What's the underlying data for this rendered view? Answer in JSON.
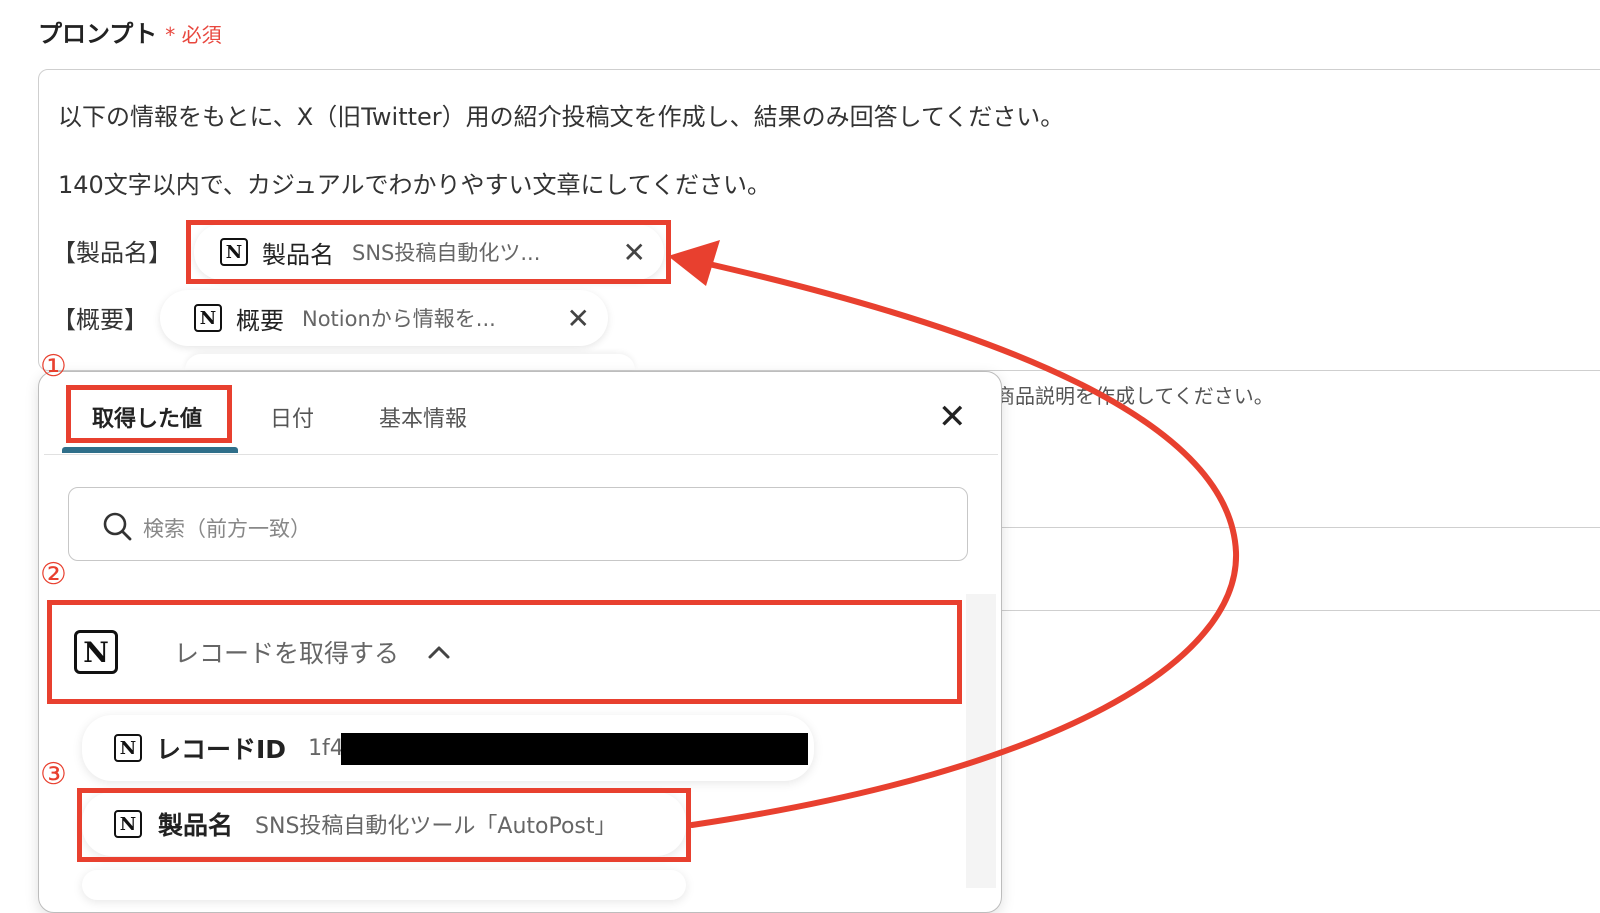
{
  "field": {
    "title": "プロンプト",
    "required_mark": "*",
    "required_label": "必須"
  },
  "prompt": {
    "line1": "以下の情報をもとに、X（旧Twitter）用の紹介投稿文を作成し、結果のみ回答してください。",
    "line2": "140文字以内で、カジュアルでわかりやすい文章にしてください。",
    "label_product": "【製品名】",
    "label_summary": "【概要】",
    "chip_product": {
      "label": "製品名",
      "value": "SNS投稿自動化ツ..."
    },
    "chip_summary": {
      "label": "概要",
      "value": "Notionから情報を..."
    },
    "bg_text": "商品説明を作成してください。"
  },
  "panel": {
    "tabs": [
      {
        "label": "取得した値"
      },
      {
        "label": "日付"
      },
      {
        "label": "基本情報"
      }
    ],
    "search_placeholder": "検索（前方一致）",
    "group": {
      "label": "レコードを取得する"
    },
    "items": [
      {
        "label": "レコードID",
        "value": "1f4"
      },
      {
        "label": "製品名",
        "value": "SNS投稿自動化ツール「AutoPost」"
      }
    ]
  },
  "annotations": {
    "step1": "①",
    "step2": "②",
    "step3": "③"
  },
  "icons": {
    "notion": "notion-icon",
    "close": "close-icon",
    "search": "search-icon",
    "chevron": "chevron-up-icon"
  },
  "colors": {
    "annotation": "#e8402f",
    "tab_active": "#2f6f8a"
  }
}
